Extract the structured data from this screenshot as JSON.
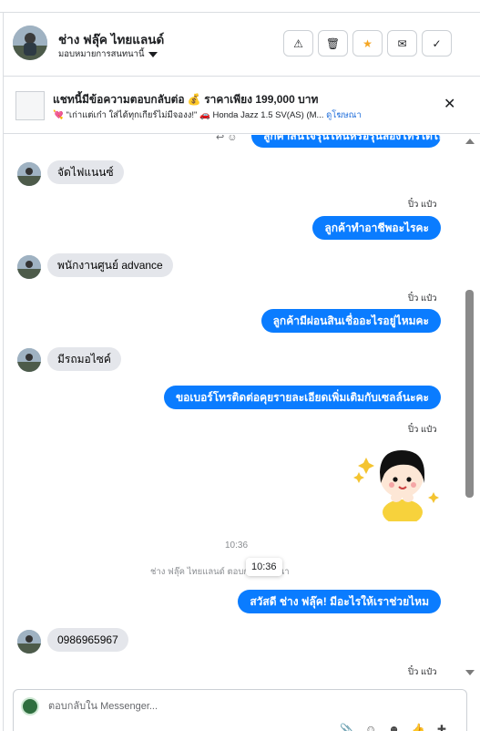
{
  "header": {
    "name": "ช่าง ฟลุ๊ค ไทยแลนด์",
    "assign_label": "มอบหมายการสนทนานี้",
    "actions": [
      {
        "name": "alert-icon",
        "glyph": "⚠"
      },
      {
        "name": "trash-icon",
        "glyph": "🗑"
      },
      {
        "name": "star-icon",
        "glyph": "★"
      },
      {
        "name": "mail-icon",
        "glyph": "✉"
      },
      {
        "name": "check-icon",
        "glyph": "✓"
      }
    ]
  },
  "banner": {
    "title": "แชทนี้มีข้อความตอบกลับต่อ 💰 ราคาเพียง 199,000 บาท",
    "subtitle": "💘 \"เก่าแต่เก๋า ใส่ได้ทุกเกียร์ไม่มีจองง!\" 🚗 Honda Jazz 1.5 SV(AS) (M...",
    "link": "ดูโฆษณา",
    "close_glyph": "✕"
  },
  "conversation": {
    "top_partial_message": "ลูกค้าสนใจรุ่นไหนหรือรุ่นลองโทรได้ไหมคะ",
    "top_icons": "↩ ☺",
    "messages": [
      {
        "dir": "in",
        "text": "จัดไฟแนนซ์"
      },
      {
        "dir": "out",
        "sender": "ปิ๋ว แป๋ว",
        "text": "ลูกค้าทำอาชีพอะไรคะ"
      },
      {
        "dir": "in",
        "text": "พนักงานศูนย์ advance"
      },
      {
        "dir": "out",
        "sender": "ปิ๋ว แป๋ว",
        "text": "ลูกค้ามีผ่อนสินเชื่ออะไรอยู่ไหมคะ"
      },
      {
        "dir": "in",
        "text": "มีรถมอไซค์"
      },
      {
        "dir": "out",
        "text": "ขอเบอร์โทรติดต่อคุยรายละเอียดเพิ่มเติมกับเซลล์นะคะ"
      },
      {
        "dir": "out",
        "sender": "ปิ๋ว แป๋ว",
        "sticker": true
      },
      {
        "dir": "out",
        "text": "สวัสดี ช่าง ฟลุ๊ค! มีอะไรให้เราช่วยไหม"
      },
      {
        "dir": "in",
        "text": "0986965967"
      },
      {
        "dir": "out",
        "sender": "ปิ๋ว แป๋ว"
      }
    ],
    "timestamp": "10:36",
    "system_note": "ช่าง ฟลุ๊ค ไทยแลนด์ ตอบกลับโฆษณา",
    "tooltip": "10:36"
  },
  "composer": {
    "placeholder": "ตอบกลับใน Messenger...",
    "tools": [
      "📎",
      "☺",
      "☻",
      "👍",
      "✚"
    ]
  }
}
